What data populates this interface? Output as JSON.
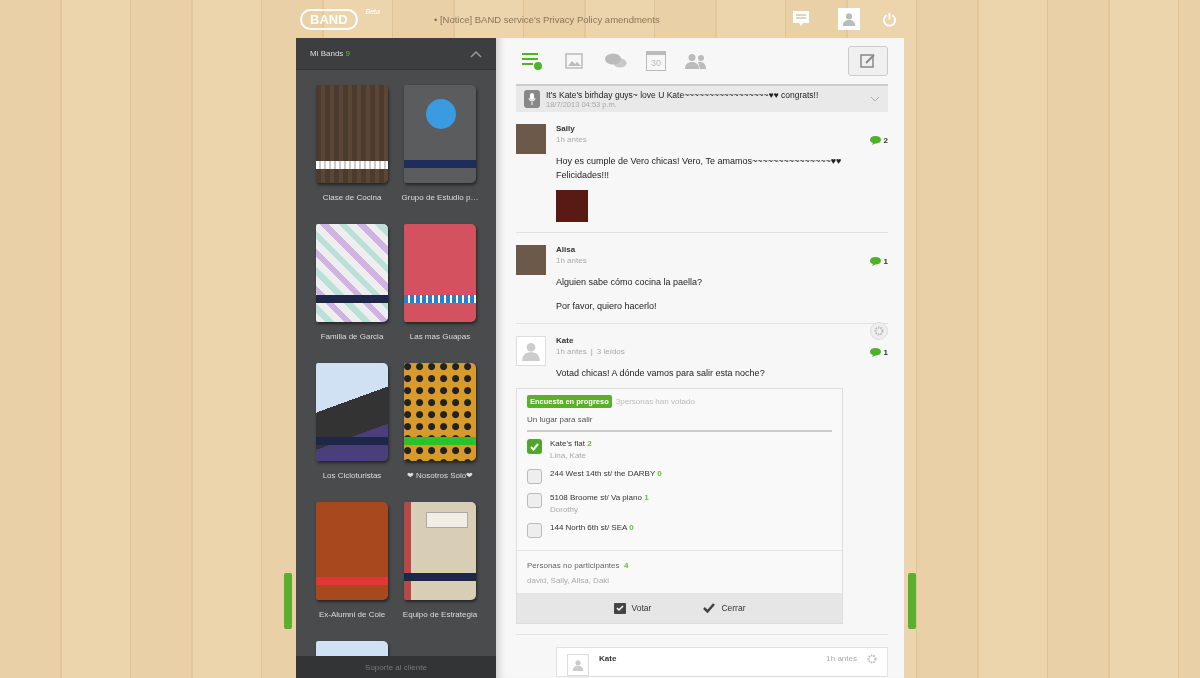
{
  "header": {
    "logo": "BAND",
    "logo_badge": "Beta",
    "notice": "• [Notice] BAND service's Privacy Policy amendments"
  },
  "sidebar": {
    "title": "Mi Bands",
    "count": "9",
    "footer": "Soporte al cliente",
    "bands": [
      {
        "name": "Clase de Cocina",
        "kind": "wood"
      },
      {
        "name": "Grupo de Estudio p…",
        "kind": "planet"
      },
      {
        "name": "Familia de Garcia",
        "kind": "stripes"
      },
      {
        "name": "Las mas Guapas",
        "kind": "pink"
      },
      {
        "name": "Los Cicloturistas",
        "kind": "photo"
      },
      {
        "name": "❤ Nosotros Solo❤",
        "kind": "leopard"
      },
      {
        "name": "Ex-Alumni de Cole",
        "kind": "leather"
      },
      {
        "name": "Equipo de Estrategia",
        "kind": "notebook"
      },
      {
        "kind": "photo"
      }
    ]
  },
  "tabs": [
    {
      "kind": "posts",
      "selected": true
    },
    {
      "kind": "photos",
      "selected": false
    },
    {
      "kind": "chat",
      "selected": false
    },
    {
      "kind": "calendar",
      "selected": false,
      "label": "30"
    },
    {
      "kind": "members",
      "selected": false
    }
  ],
  "notice_post": {
    "text": "It's Kate's birhday guys~ love U Kate~~~~~~~~~~~~~~~~~♥♥ congrats!!",
    "date": "18/7/2013 04:53 p.m."
  },
  "posts": [
    {
      "kind": "text",
      "author": "Sally",
      "avatar_photo": true,
      "time": "1h antes",
      "comments": "2",
      "paragraphs": [
        "Hoy es cumple de Vero chicas! Vero, Te amamos~~~~~~~~~~~~~~~♥♥\nFelicidades!!!"
      ],
      "photo": true
    },
    {
      "kind": "text",
      "author": "Alisa",
      "avatar_photo": true,
      "time": "1h antes",
      "comments": "1",
      "paragraphs": [
        "Alguien sabe cómo cocina la paella?",
        "Por favor, quiero hacerlo!"
      ]
    },
    {
      "kind": "poll",
      "author": "Kate",
      "avatar_photo": false,
      "time": "1h antes",
      "separator": "|",
      "reads": "3 leídos",
      "comments": "1",
      "paragraphs": [
        "Votad chicas! A dónde vamos para salir esta noche?"
      ],
      "poll": {
        "status": "Encuesta en progreso",
        "voted": "3personas han votado",
        "question": "Un lugar para salir",
        "options": [
          {
            "label": "Kate's flat",
            "count": "2",
            "voters": "Lina, Kate",
            "checked": true
          },
          {
            "label": "244 West 14th st/ the DARBY",
            "count": "0",
            "checked": false
          },
          {
            "label": "5108 Broome st/ Va piano",
            "count": "1",
            "voters": "Dorothy",
            "checked": false
          },
          {
            "label": "144 North 6th st/ SEA",
            "count": "0",
            "checked": false
          }
        ],
        "non_participants_label": "Personas no participantes",
        "non_participants_count": "4",
        "non_participants": "david, Sally, Alisa, Daki",
        "buttons": [
          {
            "kind": "vote",
            "label": "Votar"
          },
          {
            "kind": "close",
            "label": "Cerrar"
          }
        ]
      }
    }
  ],
  "partial_post": {
    "author": "Kate",
    "time": "1h antes"
  }
}
